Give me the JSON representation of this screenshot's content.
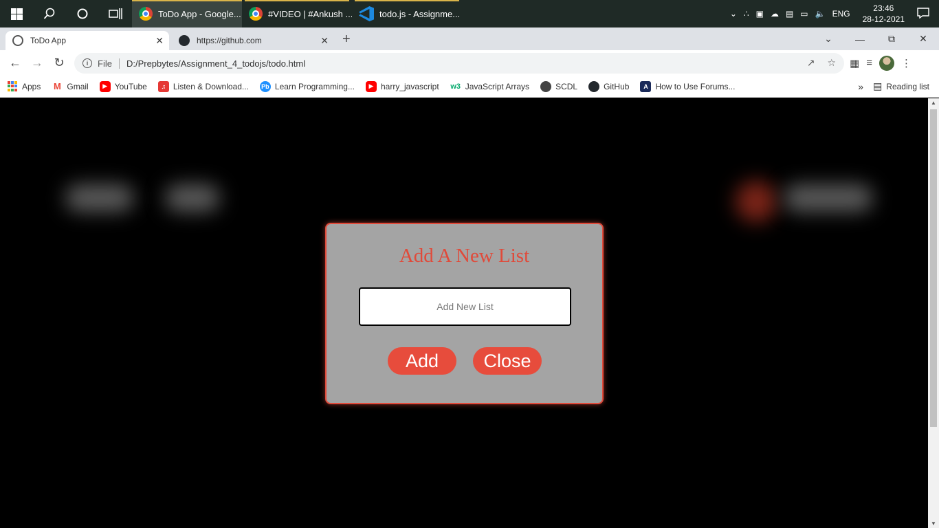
{
  "taskbar": {
    "apps": [
      {
        "label": "ToDo App - Google...",
        "icon": "chrome-icon",
        "active": true
      },
      {
        "label": "#VIDEO | #Ankush ...",
        "icon": "chrome-icon",
        "active": false
      },
      {
        "label": "todo.js - Assignme...",
        "icon": "vscode-icon",
        "active": false
      }
    ],
    "language": "ENG",
    "time": "23:46",
    "date": "28-12-2021"
  },
  "browser": {
    "tabs": [
      {
        "title": "ToDo App",
        "icon": "globe-icon",
        "active": true
      },
      {
        "title": "https://github.com",
        "icon": "github-icon",
        "active": false
      }
    ],
    "address": {
      "scheme_label": "File",
      "url": "D:/Prepbytes/Assignment_4_todojs/todo.html"
    },
    "bookmarks": [
      {
        "label": "Apps",
        "icon": "apps-grid-icon",
        "color": "#4285f4"
      },
      {
        "label": "Gmail",
        "icon": "gmail-icon",
        "color": "#ea4335"
      },
      {
        "label": "YouTube",
        "icon": "youtube-icon",
        "color": "#ff0000"
      },
      {
        "label": "Listen & Download...",
        "icon": "music-icon",
        "color": "#e53935"
      },
      {
        "label": "Learn Programming...",
        "icon": "pb-icon",
        "color": "#1e90ff"
      },
      {
        "label": "harry_javascript",
        "icon": "youtube-icon",
        "color": "#ff0000"
      },
      {
        "label": "JavaScript Arrays",
        "icon": "w3-icon",
        "color": "#04aa6d"
      },
      {
        "label": "SCDL",
        "icon": "globe-icon",
        "color": "#444444"
      },
      {
        "label": "GitHub",
        "icon": "github-icon",
        "color": "#24292e"
      },
      {
        "label": "How to Use Forums...",
        "icon": "forum-icon",
        "color": "#1a2a5a"
      }
    ],
    "reading_list": "Reading list"
  },
  "modal": {
    "title": "Add A New List",
    "input_placeholder": "Add New List",
    "input_value": "",
    "add_label": "Add",
    "close_label": "Close",
    "accent": "#e74c3c"
  }
}
